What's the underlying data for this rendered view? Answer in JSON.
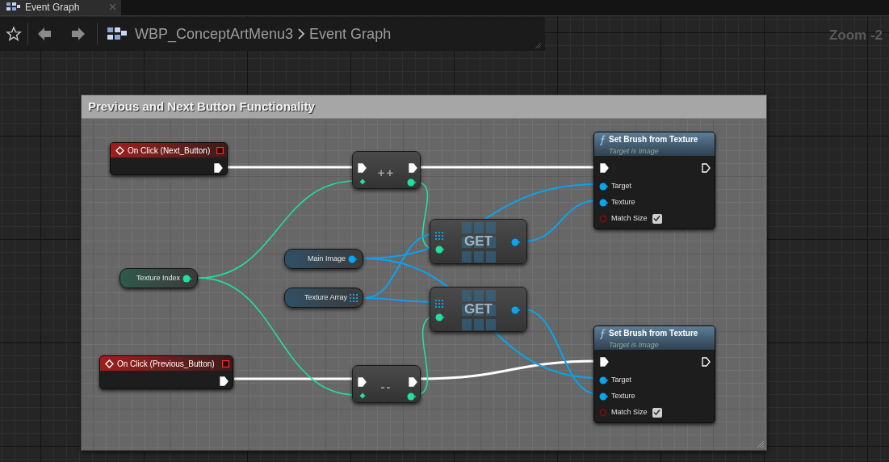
{
  "tab": {
    "title": "Event Graph",
    "selected": true
  },
  "breadcrumb": [
    "WBP_ConceptArtMenu3",
    "Event Graph"
  ],
  "zoom_label": "Zoom -2",
  "comment": {
    "title": "Previous and Next Button Functionality"
  },
  "nodes": [
    {
      "kind": "event",
      "title": "On Click (Next_Button)"
    },
    {
      "kind": "macro",
      "symbol": "++"
    },
    {
      "kind": "function",
      "title": "Set Brush from Texture",
      "subtitle": "Target is Image",
      "pins": [
        {
          "label": "Target",
          "kind": "object"
        },
        {
          "label": "Texture",
          "kind": "object"
        },
        {
          "label": "Match Size",
          "kind": "bool",
          "checked": true
        }
      ]
    },
    {
      "kind": "variable",
      "label": "Main Image",
      "pin": {
        "kind": "object"
      }
    },
    {
      "kind": "variable",
      "label": "Texture Index",
      "pin": {
        "kind": "integer"
      }
    },
    {
      "kind": "get",
      "label": "GET"
    },
    {
      "kind": "variable",
      "label": "Texture Array",
      "pin": {
        "kind": "array"
      }
    },
    {
      "kind": "get",
      "label": "GET"
    },
    {
      "kind": "event",
      "title": "On Click (Previous_Button)"
    },
    {
      "kind": "macro",
      "symbol": "--"
    },
    {
      "kind": "function",
      "title": "Set Brush from Texture",
      "subtitle": "Target is Image",
      "pins": [
        {
          "label": "Target",
          "kind": "object"
        },
        {
          "label": "Texture",
          "kind": "object"
        },
        {
          "label": "Match Size",
          "kind": "bool",
          "checked": true
        }
      ]
    }
  ]
}
